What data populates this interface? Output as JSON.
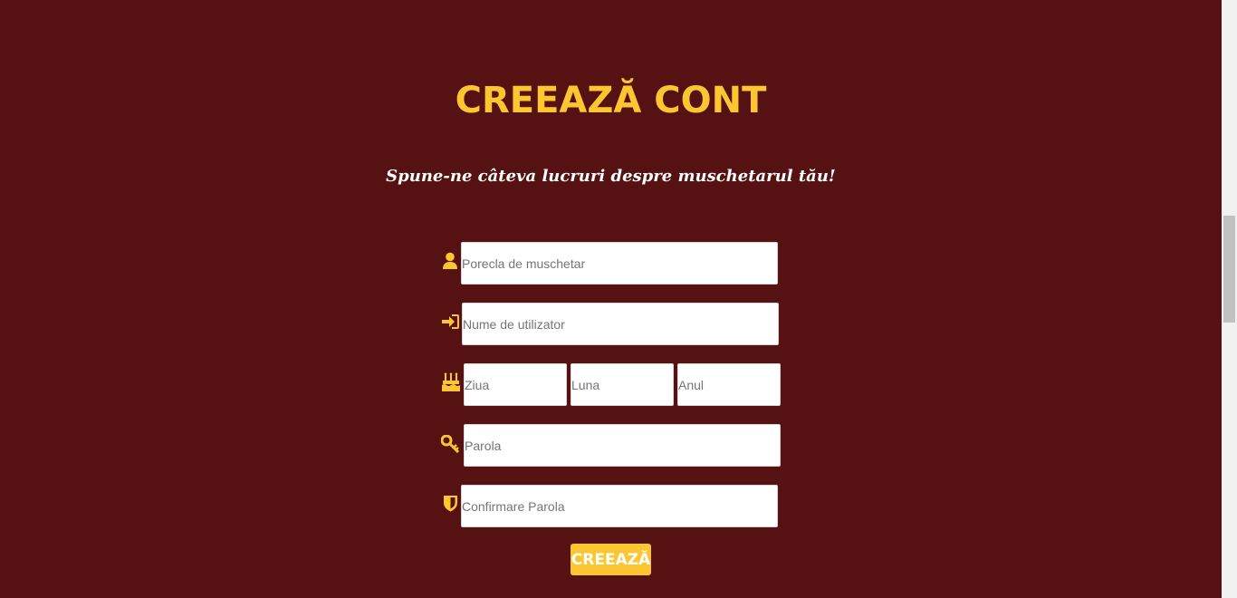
{
  "heading": {
    "title": "CREEAZĂ CONT",
    "subtitle": "Spune-ne câteva lucruri despre muschetarul tău!"
  },
  "form": {
    "nickname_placeholder": "Porecla de muschetar",
    "username_placeholder": "Nume de utilizator",
    "day_placeholder": "Ziua",
    "month_placeholder": "Luna",
    "year_placeholder": "Anul",
    "password_placeholder": "Parola",
    "confirm_password_placeholder": "Confirmare Parola",
    "submit_label": "CREEAZĂ"
  },
  "icons": [
    "user-icon",
    "sign-in-icon",
    "birthday-cake-icon",
    "key-icon",
    "shield-icon"
  ],
  "colors": {
    "background": "#561113",
    "accent": "#fcc630",
    "subtitle": "#ffffff",
    "input_bg": "#ffffff"
  }
}
